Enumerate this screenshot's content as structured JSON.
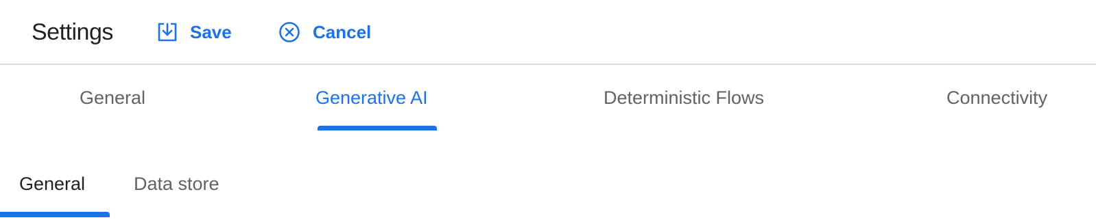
{
  "header": {
    "title": "Settings",
    "save_label": "Save",
    "cancel_label": "Cancel"
  },
  "main_tabs": [
    {
      "label": "General",
      "active": false
    },
    {
      "label": "Generative AI",
      "active": true
    },
    {
      "label": "Deterministic Flows",
      "active": false
    },
    {
      "label": "Connectivity",
      "active": false
    }
  ],
  "sub_tabs": [
    {
      "label": "General",
      "active": true
    },
    {
      "label": "Data store",
      "active": false
    }
  ],
  "icons": {
    "save": "save-download-icon",
    "cancel": "cancel-circle-x-icon"
  },
  "colors": {
    "accent": "#1a73e8",
    "text_primary": "#202124",
    "text_secondary": "#5f6368",
    "divider": "#dadce0"
  }
}
